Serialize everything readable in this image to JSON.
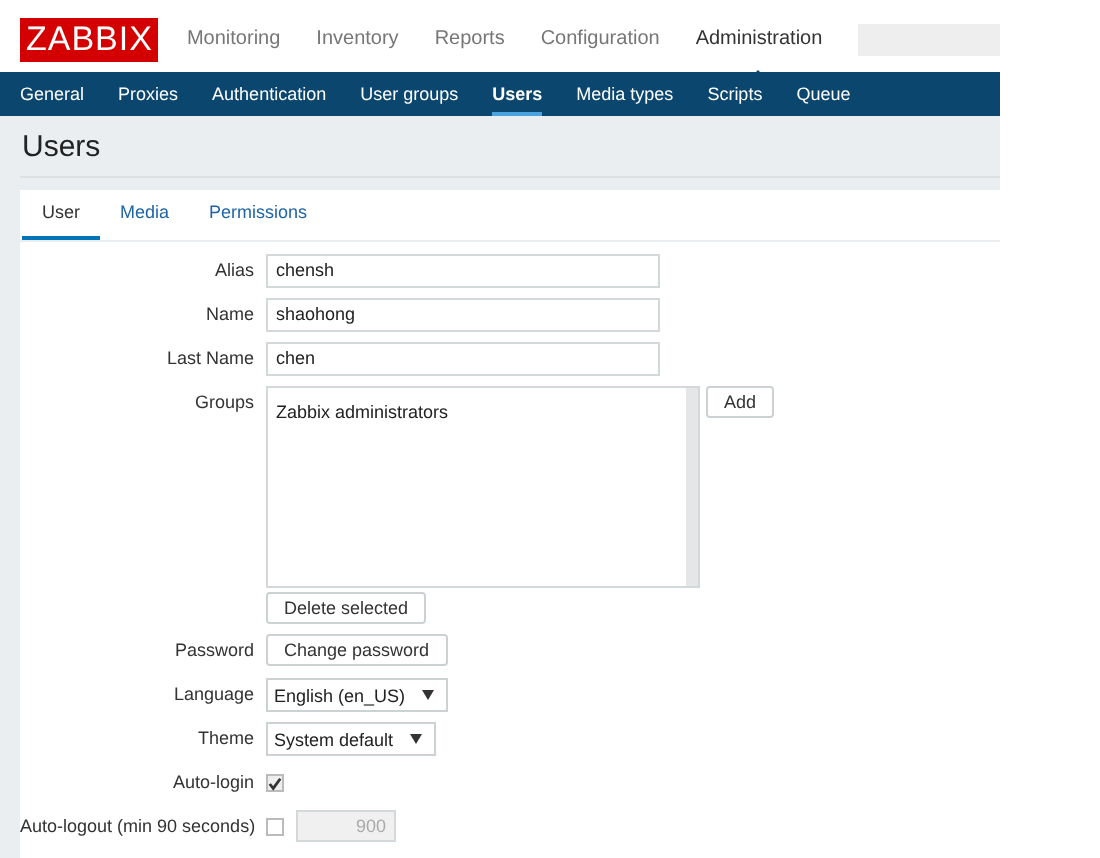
{
  "header": {
    "logo": "ZABBIX",
    "menu": [
      {
        "label": "Monitoring",
        "selected": false
      },
      {
        "label": "Inventory",
        "selected": false
      },
      {
        "label": "Reports",
        "selected": false
      },
      {
        "label": "Configuration",
        "selected": false
      },
      {
        "label": "Administration",
        "selected": true
      }
    ]
  },
  "submenu": [
    {
      "label": "General",
      "selected": false
    },
    {
      "label": "Proxies",
      "selected": false
    },
    {
      "label": "Authentication",
      "selected": false
    },
    {
      "label": "User groups",
      "selected": false
    },
    {
      "label": "Users",
      "selected": true
    },
    {
      "label": "Media types",
      "selected": false
    },
    {
      "label": "Scripts",
      "selected": false
    },
    {
      "label": "Queue",
      "selected": false
    }
  ],
  "page_title": "Users",
  "tabs": [
    {
      "label": "User",
      "selected": true
    },
    {
      "label": "Media",
      "selected": false
    },
    {
      "label": "Permissions",
      "selected": false
    }
  ],
  "form": [
    {
      "kind": "text",
      "label": "Alias",
      "value": "chensh"
    },
    {
      "kind": "text",
      "label": "Name",
      "value": "shaohong"
    },
    {
      "kind": "text",
      "label": "Last Name",
      "value": "chen"
    },
    {
      "kind": "listbox",
      "label": "Groups",
      "items": [
        "Zabbix administrators"
      ],
      "button": "Add",
      "below_button": "Delete selected"
    },
    {
      "kind": "button",
      "label": "Password",
      "button": "Change password"
    },
    {
      "kind": "select",
      "label": "Language",
      "value": "English (en_US)"
    },
    {
      "kind": "select",
      "label": "Theme",
      "value": "System default"
    },
    {
      "kind": "checkbox",
      "label": "Auto-login",
      "checked": true
    },
    {
      "kind": "checkbox_number",
      "label": "Auto-logout (min 90 seconds)",
      "checked": false,
      "value": "900",
      "disabled": true
    }
  ]
}
